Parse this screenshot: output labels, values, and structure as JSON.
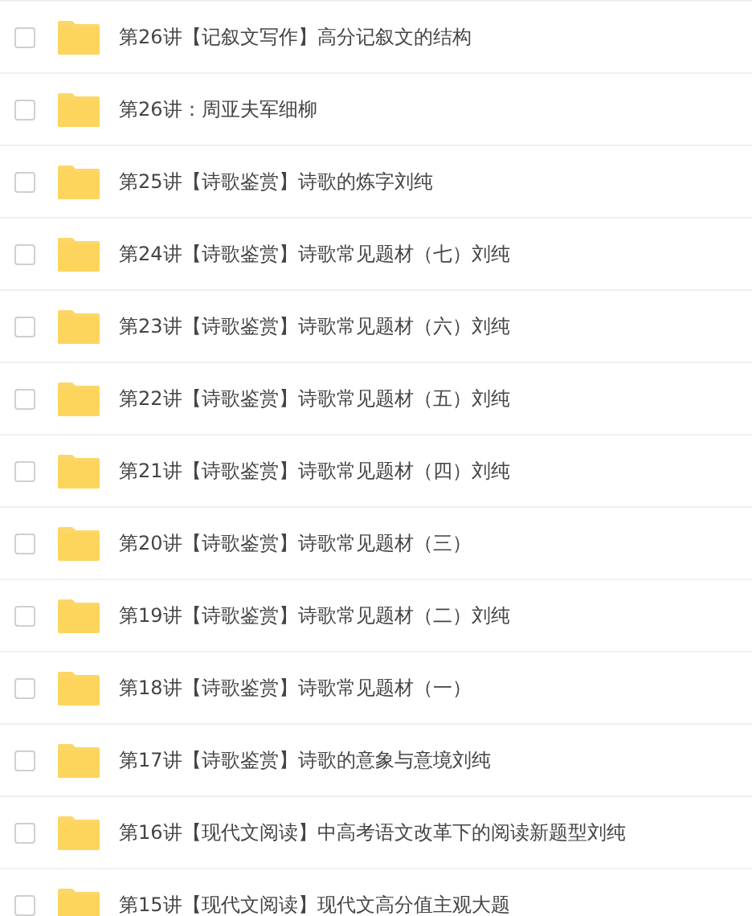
{
  "files": [
    {
      "name": "第26讲【记叙文写作】高分记叙文的结构",
      "checked": false
    },
    {
      "name": "第26讲：周亚夫军细柳",
      "checked": false
    },
    {
      "name": "第25讲【诗歌鉴赏】诗歌的炼字刘纯",
      "checked": false
    },
    {
      "name": "第24讲【诗歌鉴赏】诗歌常见题材（七）刘纯",
      "checked": false
    },
    {
      "name": "第23讲【诗歌鉴赏】诗歌常见题材（六）刘纯",
      "checked": false
    },
    {
      "name": "第22讲【诗歌鉴赏】诗歌常见题材（五）刘纯",
      "checked": false
    },
    {
      "name": "第21讲【诗歌鉴赏】诗歌常见题材（四）刘纯",
      "checked": false
    },
    {
      "name": "第20讲【诗歌鉴赏】诗歌常见题材（三）",
      "checked": false
    },
    {
      "name": "第19讲【诗歌鉴赏】诗歌常见题材（二）刘纯",
      "checked": false
    },
    {
      "name": "第18讲【诗歌鉴赏】诗歌常见题材（一）",
      "checked": false
    },
    {
      "name": "第17讲【诗歌鉴赏】诗歌的意象与意境刘纯",
      "checked": false
    },
    {
      "name": "第16讲【现代文阅读】中高考语文改革下的阅读新题型刘纯",
      "checked": false
    },
    {
      "name": "第15讲【现代文阅读】现代文高分值主观大题",
      "checked": false
    }
  ]
}
